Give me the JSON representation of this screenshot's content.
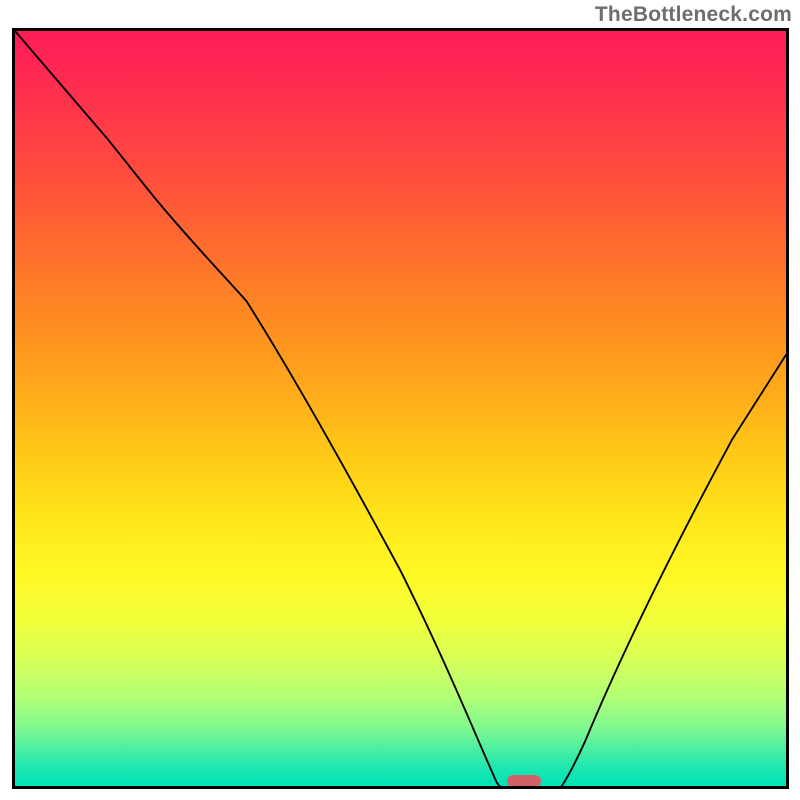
{
  "attribution": "TheBottleneck.com",
  "colors": {
    "border": "#000000",
    "curve": "#000000",
    "pill": "#d36068",
    "gradient_stops": [
      "#ff1b57",
      "#ff2f4e",
      "#ff4a3f",
      "#ff6a2f",
      "#ff8a22",
      "#ffab1a",
      "#ffc917",
      "#ffe41a",
      "#fff825",
      "#f1ff3a",
      "#d8ff56",
      "#b4ff73",
      "#84f98e",
      "#4eefa1",
      "#1ee7b0",
      "#00e1b7"
    ]
  },
  "chart_data": {
    "type": "line",
    "title": "",
    "xlabel": "",
    "ylabel": "",
    "xlim": [
      0,
      100
    ],
    "ylim": [
      0,
      100
    ],
    "x": [
      0,
      5,
      10,
      15,
      20,
      25,
      30,
      35,
      40,
      45,
      50,
      55,
      60,
      62,
      65,
      68,
      70,
      75,
      80,
      85,
      90,
      95,
      100
    ],
    "values": [
      100,
      94,
      88,
      82,
      77,
      73,
      65,
      56,
      46,
      36,
      26,
      16,
      6,
      2,
      0,
      0,
      2,
      10,
      21,
      33,
      45,
      57,
      57
    ],
    "annotations": [
      {
        "name": "optimal-marker",
        "x": 66,
        "y": 0.5,
        "shape": "pill",
        "color": "#d36068"
      }
    ],
    "notes": "Bottleneck-percentage-style curve. Minimum (0%) around x≈65–68 where the pink pill marker sits at the baseline. Left branch descends from ~100 at x=0 with a mild knee near x≈25; right branch rises to ~57 at x=100."
  }
}
